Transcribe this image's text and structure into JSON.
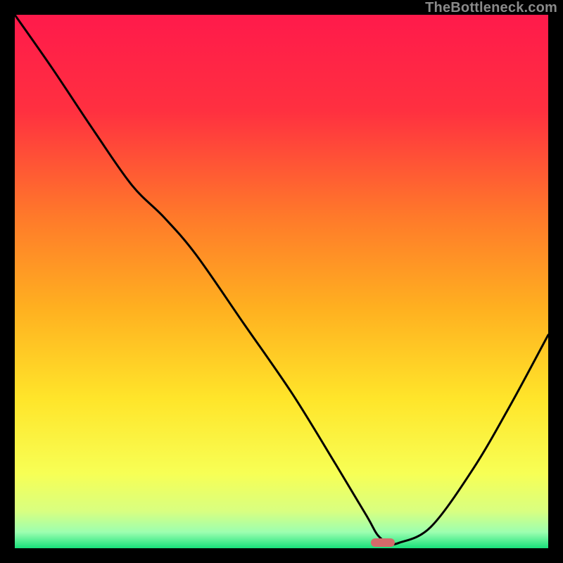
{
  "watermark": {
    "text": "TheBottleneck.com"
  },
  "chart_data": {
    "type": "line",
    "title": "",
    "xlabel": "",
    "ylabel": "",
    "xlim": [
      0,
      100
    ],
    "ylim": [
      0,
      100
    ],
    "grid": false,
    "legend": false,
    "background_gradient": [
      {
        "pos": 0.0,
        "color": "#ff1a4b"
      },
      {
        "pos": 0.18,
        "color": "#ff3040"
      },
      {
        "pos": 0.38,
        "color": "#ff7a2a"
      },
      {
        "pos": 0.55,
        "color": "#ffb020"
      },
      {
        "pos": 0.72,
        "color": "#ffe52a"
      },
      {
        "pos": 0.86,
        "color": "#f7ff55"
      },
      {
        "pos": 0.93,
        "color": "#d9ff80"
      },
      {
        "pos": 0.97,
        "color": "#9cffb0"
      },
      {
        "pos": 1.0,
        "color": "#18e07a"
      }
    ],
    "series": [
      {
        "name": "bottleneck-curve",
        "color": "#000000",
        "x": [
          0.0,
          7.0,
          15.0,
          22.0,
          28.0,
          34.0,
          43.0,
          52.0,
          60.0,
          66.0,
          68.0,
          70.0,
          72.0,
          78.0,
          86.0,
          93.0,
          100.0
        ],
        "y": [
          100.0,
          90.0,
          78.0,
          68.0,
          62.0,
          55.0,
          42.0,
          29.0,
          16.0,
          6.0,
          2.5,
          1.0,
          1.0,
          4.0,
          15.0,
          27.0,
          40.0
        ]
      }
    ],
    "marker": {
      "name": "optimal-segment",
      "color": "#d46a6a",
      "x_center": 69.0,
      "y_center": 1.0,
      "width_pct": 4.5,
      "height_pct": 1.6
    }
  }
}
